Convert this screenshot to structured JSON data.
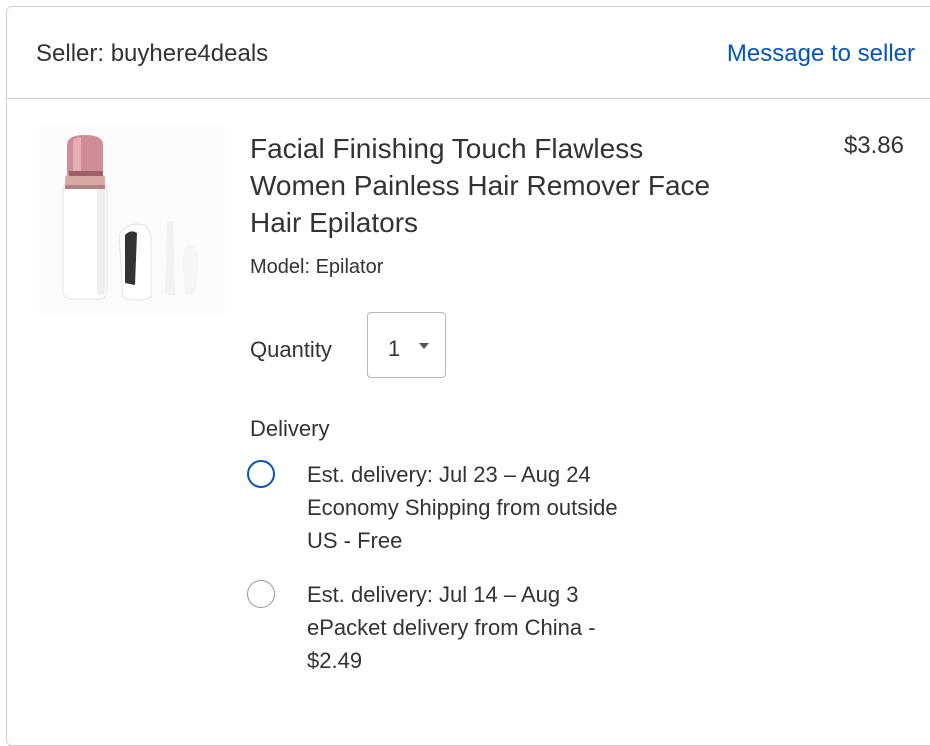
{
  "seller": {
    "label": "Seller: buyhere4deals",
    "message_link": "Message to seller"
  },
  "item": {
    "title": "Facial Finishing Touch Flawless Women Painless Hair Remover Face Hair Epilators",
    "price": "$3.86",
    "model": "Model: Epilator",
    "image_icon": "epilator-product-image"
  },
  "quantity": {
    "label": "Quantity",
    "value": "1"
  },
  "delivery": {
    "label": "Delivery",
    "options": [
      {
        "line1": "Est. delivery: Jul 23 – Aug 24",
        "line2": "Economy Shipping from outside",
        "line3": "US - Free",
        "selected": true
      },
      {
        "line1": "Est. delivery: Jul 14 – Aug 3",
        "line2": "ePacket delivery from China -",
        "line3": "$2.49",
        "selected": false
      }
    ]
  },
  "colors": {
    "link": "#0654ba",
    "text": "#333333",
    "border": "#cfcfcf",
    "accent_pink": "#c98a8f"
  }
}
